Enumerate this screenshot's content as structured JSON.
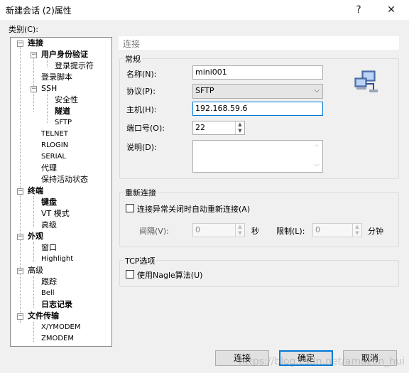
{
  "window": {
    "title": "新建会话 (2)属性",
    "help_glyph": "?",
    "close_glyph": "✕"
  },
  "category_label": "类别(C):",
  "tree": {
    "connection": "连接",
    "auth": "用户身份验证",
    "login_prompts": "登录提示符",
    "login_scripts": "登录脚本",
    "ssh": "SSH",
    "security": "安全性",
    "tunnel": "隧道",
    "sftp": "SFTP",
    "telnet": "TELNET",
    "rlogin": "RLOGIN",
    "serial": "SERIAL",
    "proxy": "代理",
    "keepalive": "保持活动状态",
    "terminal": "终端",
    "keyboard": "键盘",
    "vt_mode": "VT 模式",
    "term_advanced": "高级",
    "appearance": "外观",
    "window": "窗口",
    "highlight": "Highlight",
    "advanced": "高级",
    "trace": "跟踪",
    "bell": "Bell",
    "logging": "日志记录",
    "file_transfer": "文件传输",
    "xymodem": "X/YMODEM",
    "zmodem": "ZMODEM"
  },
  "panel_title": "连接",
  "general": {
    "label": "常规",
    "name_label": "名称(N):",
    "name_value": "mini001",
    "protocol_label": "协议(P):",
    "protocol_value": "SFTP",
    "host_label": "主机(H):",
    "host_value": "192.168.59.6",
    "port_label": "端口号(O):",
    "port_value": "22",
    "desc_label": "说明(D):",
    "desc_value": ""
  },
  "reconnect": {
    "label": "重新连接",
    "auto_label": "连接异常关闭时自动重新连接(A)",
    "interval_label": "间隔(V):",
    "interval_value": "0",
    "sec_unit": "秒",
    "limit_label": "限制(L):",
    "limit_value": "0",
    "min_unit": "分钟"
  },
  "tcp": {
    "label": "TCP选项",
    "nagle_label": "使用Nagle算法(U)"
  },
  "buttons": {
    "connect": "连接",
    "ok": "确定",
    "cancel": "取消"
  },
  "watermark": "https://blog.csdn.net/amazon_hui",
  "icons": {
    "network": "network-computers-icon"
  }
}
